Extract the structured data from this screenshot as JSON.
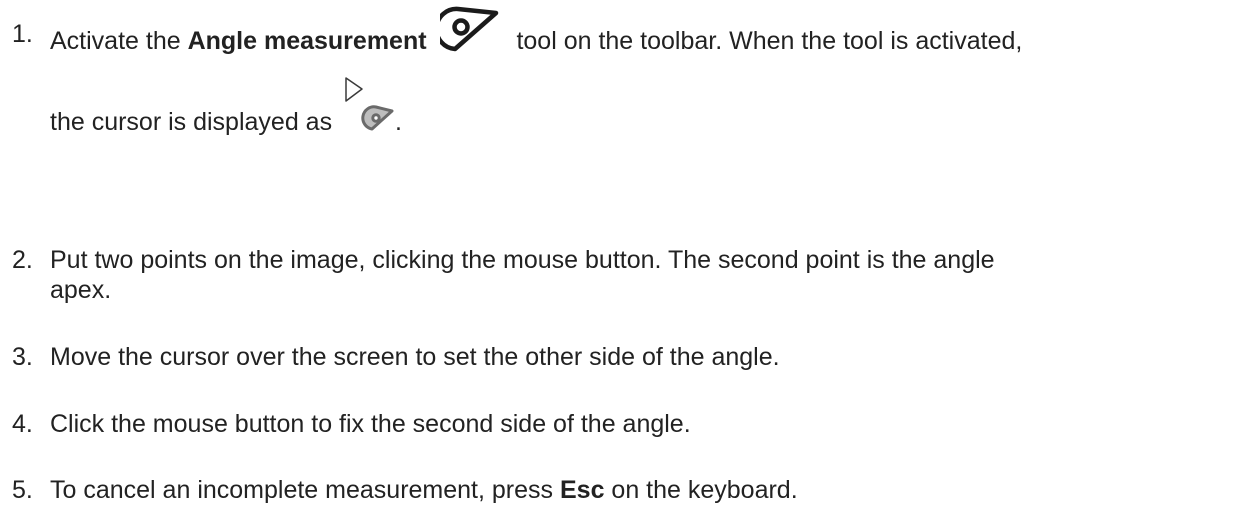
{
  "steps": [
    {
      "number": "1.",
      "line1_pre": "Activate the ",
      "line1_bold": "Angle measurement",
      "line1_post": "tool on the toolbar. When the tool is activated,",
      "line2_pre": "the cursor is displayed as",
      "line2_post": ".",
      "tool_icon": "protractor-icon",
      "cursor_icon": "arrow-cursor-with-protractor-icon"
    },
    {
      "number": "2.",
      "line1": "Put two points on the image, clicking the mouse button. The second point is the angle",
      "line2": "apex."
    },
    {
      "number": "3.",
      "line1": "Move the cursor over the screen to set the other side of the angle."
    },
    {
      "number": "4.",
      "line1": "Click the mouse button to fix the second side of the angle."
    },
    {
      "number": "5.",
      "line1_pre": "To cancel an incomplete measurement, press ",
      "line1_bold": "Esc",
      "line1_post": " on the keyboard."
    }
  ]
}
